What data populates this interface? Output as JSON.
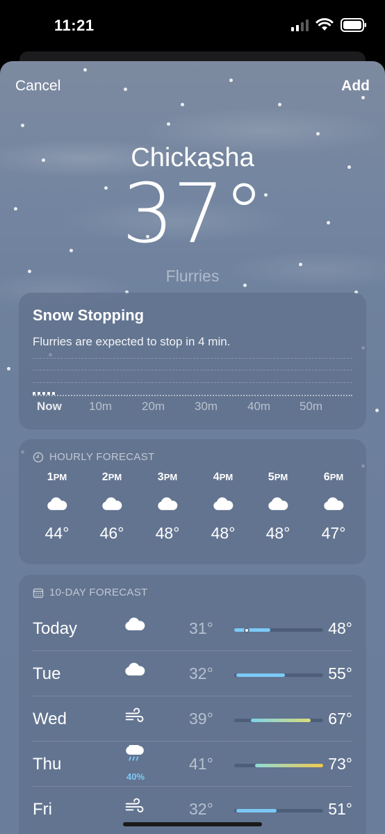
{
  "status_bar": {
    "time": "11:21"
  },
  "nav": {
    "cancel_label": "Cancel",
    "add_label": "Add"
  },
  "location": {
    "city": "Chickasha",
    "temperature": "37°",
    "condition": "Flurries"
  },
  "precipitation": {
    "title": "Snow Stopping",
    "subtitle": "Flurries are expected to stop in 4 min.",
    "ticks": [
      "Now",
      "10m",
      "20m",
      "30m",
      "40m",
      "50m"
    ]
  },
  "hourly": {
    "header": "HOURLY FORECAST",
    "header_icon": "clock-icon",
    "hours": [
      {
        "hour": "1",
        "ampm": "PM",
        "icon": "cloud-icon",
        "temp": "44°"
      },
      {
        "hour": "2",
        "ampm": "PM",
        "icon": "cloud-icon",
        "temp": "46°"
      },
      {
        "hour": "3",
        "ampm": "PM",
        "icon": "cloud-icon",
        "temp": "48°"
      },
      {
        "hour": "4",
        "ampm": "PM",
        "icon": "cloud-icon",
        "temp": "48°"
      },
      {
        "hour": "5",
        "ampm": "PM",
        "icon": "cloud-icon",
        "temp": "48°"
      },
      {
        "hour": "6",
        "ampm": "PM",
        "icon": "cloud-icon",
        "temp": "47°"
      }
    ]
  },
  "daily": {
    "header": "10-DAY FORECAST",
    "header_icon": "calendar-icon",
    "range_min": 31,
    "range_max": 73,
    "current_temp": 37,
    "days": [
      {
        "day": "Today",
        "icon": "cloud-icon",
        "low": "31°",
        "high": "48°",
        "low_value": 31,
        "high_value": 48,
        "pop": "",
        "bar_color": "#7cc9f7"
      },
      {
        "day": "Tue",
        "icon": "cloud-icon",
        "low": "32°",
        "high": "55°",
        "low_value": 32,
        "high_value": 55,
        "pop": "",
        "bar_color": "#7cc9f7"
      },
      {
        "day": "Wed",
        "icon": "wind-icon",
        "low": "39°",
        "high": "67°",
        "low_value": 39,
        "high_value": 67,
        "pop": "",
        "bar_color": "linear-gradient(90deg,#7cd3e8,#d9dc7a)"
      },
      {
        "day": "Thu",
        "icon": "cloud-rain-icon",
        "low": "41°",
        "high": "73°",
        "low_value": 41,
        "high_value": 73,
        "pop": "40%",
        "bar_color": "linear-gradient(90deg,#8fdbd6,#f1c94e)"
      },
      {
        "day": "Fri",
        "icon": "wind-icon",
        "low": "32°",
        "high": "51°",
        "low_value": 32,
        "high_value": 51,
        "pop": "",
        "bar_color": "#7cc9f7"
      }
    ]
  },
  "colors": {
    "accent_blue": "#7cc9f7",
    "sheet_bg": "#6b7e9b"
  }
}
